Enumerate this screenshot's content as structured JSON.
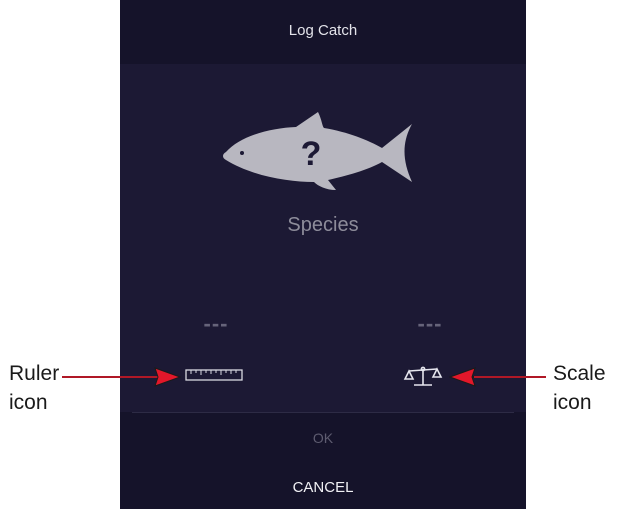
{
  "header": {
    "title": "Log Catch"
  },
  "catch": {
    "species_placeholder": "Species",
    "length_value": "---",
    "weight_value": "---",
    "unknown_mark": "?"
  },
  "icons": {
    "fish": "fish-silhouette-icon",
    "ruler": "ruler-icon",
    "scale": "scale-icon"
  },
  "footer": {
    "ok_label": "OK",
    "cancel_label": "CANCEL"
  },
  "callouts": {
    "ruler_line1": "Ruler",
    "ruler_line2": "icon",
    "scale_line1": "Scale",
    "scale_line2": "icon"
  },
  "colors": {
    "screen_bg": "#1c1934",
    "bar_bg": "#15132a",
    "arrow": "#e2172a"
  }
}
